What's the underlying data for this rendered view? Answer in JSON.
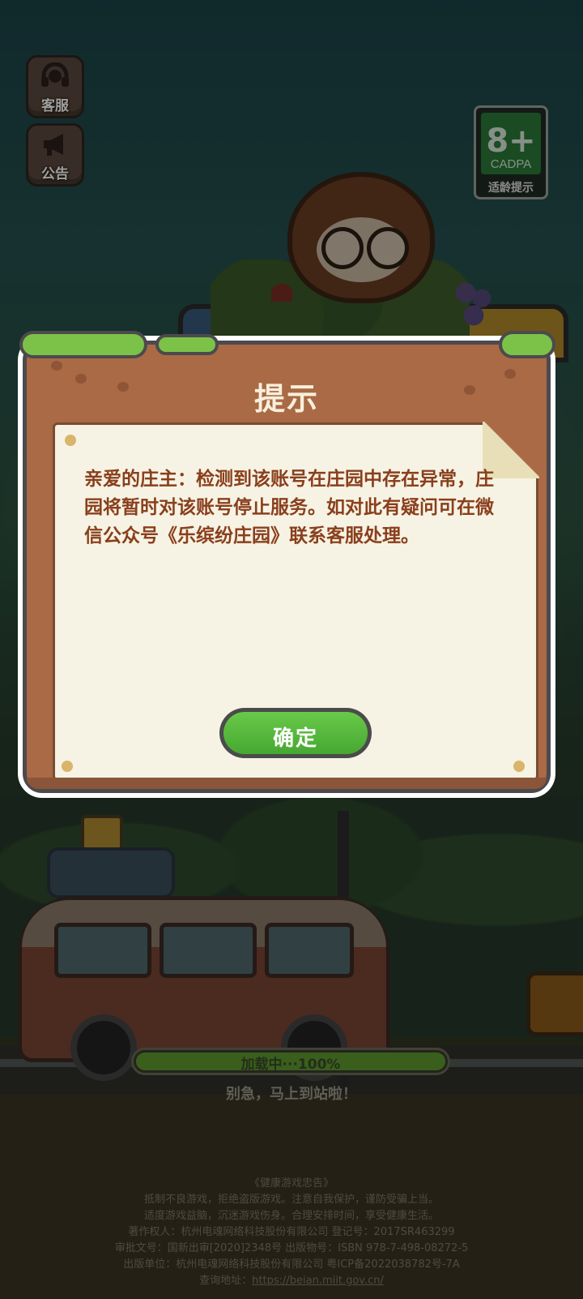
{
  "side_buttons": {
    "service_label": "客服",
    "notice_label": "公告"
  },
  "age_badge": {
    "rating": "8+",
    "org": "CADPA",
    "tip": "适龄提示"
  },
  "dialog": {
    "title": "提示",
    "message": "亲爱的庄主：检测到该账号在庄园中存在异常，庄园将暂时对该账号停止服务。如对此有疑问可在微信公众号《乐缤纷庄园》联系客服处理。",
    "confirm_label": "确定"
  },
  "loading": {
    "text": "加载中···100%",
    "progress": 1.0,
    "hint": "别急，马上到站啦！"
  },
  "footer": {
    "heading": "《健康游戏忠告》",
    "line1": "抵制不良游戏，拒绝盗版游戏。注意自我保护，谨防受骗上当。",
    "line2": "适度游戏益脑，沉迷游戏伤身。合理安排时间，享受健康生活。",
    "line3": "著作权人：杭州电魂网络科技股份有限公司  登记号：2017SR463299",
    "line4": "审批文号：国新出审[2020]2348号  出版物号：ISBN 978-7-498-08272-5",
    "line5": "出版单位：杭州电魂网络科技股份有限公司  粤ICP备2022038782号-7A",
    "query_label": "查询地址：",
    "query_url": "https://beian.miit.gov.cn/"
  },
  "colors": {
    "dialog_wood": "#a96a45",
    "paper": "#f6f3e4",
    "message_text": "#8a3f1c",
    "confirm_green": "#55b83c",
    "moss": "#7cc248"
  }
}
